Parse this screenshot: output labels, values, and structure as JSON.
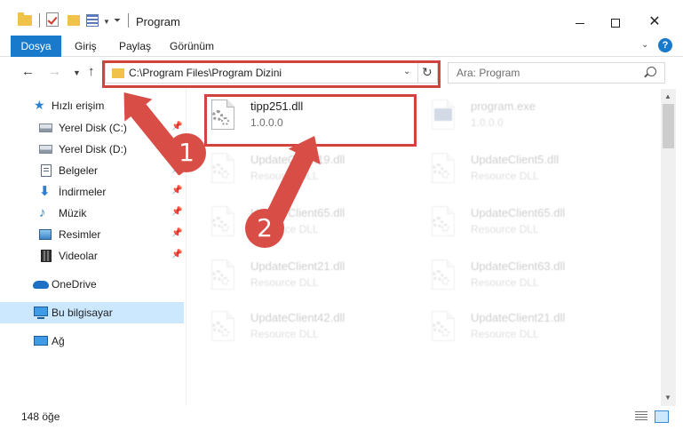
{
  "window": {
    "title": "Program"
  },
  "ribbon": {
    "tabs": [
      "Dosya",
      "Giriş",
      "Paylaş",
      "Görünüm"
    ]
  },
  "nav": {
    "address": "C:\\Program Files\\Program Dizini",
    "search_placeholder": "Ara: Program"
  },
  "sidebar": {
    "items": [
      {
        "label": "Hızlı erişim",
        "icon": "star-icon"
      },
      {
        "label": "Yerel Disk (C:)",
        "icon": "drive-icon"
      },
      {
        "label": "Yerel Disk (D:)",
        "icon": "drive-icon"
      },
      {
        "label": "Belgeler",
        "icon": "documents-icon"
      },
      {
        "label": "İndirmeler",
        "icon": "download-icon"
      },
      {
        "label": "Müzik",
        "icon": "music-icon"
      },
      {
        "label": "Resimler",
        "icon": "pictures-icon"
      },
      {
        "label": "Videolar",
        "icon": "videos-icon"
      },
      {
        "label": "OneDrive",
        "icon": "cloud-icon"
      },
      {
        "label": "Bu bilgisayar",
        "icon": "computer-icon"
      },
      {
        "label": "Ağ",
        "icon": "network-icon"
      }
    ]
  },
  "files": [
    {
      "name": "tipp251.dll",
      "sub": "1.0.0.0"
    },
    {
      "name": "program.exe",
      "sub": "1.0.0.0"
    },
    {
      "name": "UpdateClient19.dll",
      "sub": "Resource DLL"
    },
    {
      "name": "UpdateClient5.dll",
      "sub": "Resource DLL"
    },
    {
      "name": "UpdateClient65.dll",
      "sub": "Resource DLL"
    },
    {
      "name": "UpdateClient65.dll",
      "sub": "Resource DLL"
    },
    {
      "name": "UpdateClient21.dll",
      "sub": "Resource DLL"
    },
    {
      "name": "UpdateClient63.dll",
      "sub": "Resource DLL"
    },
    {
      "name": "UpdateClient42.dll",
      "sub": "Resource DLL"
    },
    {
      "name": "UpdateClient21.dll",
      "sub": "Resource DLL"
    }
  ],
  "status": {
    "count": "148 öğe"
  },
  "annotations": {
    "step1": "1",
    "step2": "2",
    "color": "#d94d47"
  },
  "colors": {
    "accent": "#1979ca",
    "selection": "#cce8ff",
    "highlight_border": "#d2423e"
  }
}
